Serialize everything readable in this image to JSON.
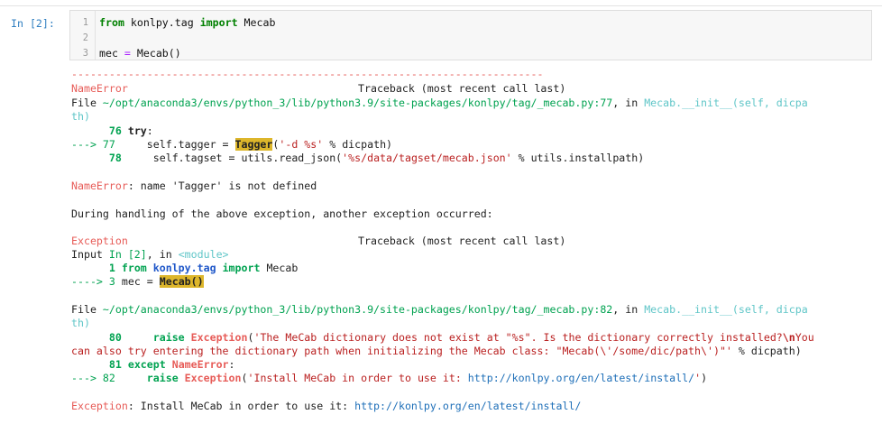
{
  "cell": {
    "prompt": "In [2]:",
    "lines": [
      {
        "num": "1",
        "kw1": "from",
        "mod": " konlpy.tag ",
        "kw2": "import",
        "name": " Mecab"
      },
      {
        "num": "2"
      },
      {
        "num": "3",
        "lhs": "mec ",
        "op": "=",
        "rhs": " Mecab()"
      }
    ]
  },
  "traceback": {
    "separator": "---------------------------------------------------------------------------",
    "first": {
      "error_name": "NameError",
      "header_right": "Traceback (most recent call last)",
      "file_prefix": "File ",
      "file_path": "~/opt/anaconda3/envs/python_3/lib/python3.9/site-packages/konlpy/tag/_mecab.py:77",
      "in_text": ", in ",
      "func": "Mecab.__init__(self, dicpa",
      "func_wrap": "th)",
      "l76_num": "76",
      "l76_kw": "try",
      "l76_colon": ":",
      "l77_arrow": "---> 77",
      "l77_pre": "     self.tagger = ",
      "l77_hl": "Tagger",
      "l77_open": "(",
      "l77_str": "'-d %s'",
      "l77_rest": " % dicpath)",
      "l78_num": "78",
      "l78_pre": "     self.tagset = utils.read_json(",
      "l78_str": "'%s/data/tagset/mecab.json'",
      "l78_rest": " % utils.installpath)",
      "msg_name": "NameError",
      "msg_text": ": name 'Tagger' is not defined"
    },
    "handling": "During handling of the above exception, another exception occurred:",
    "second": {
      "error_name": "Exception",
      "header_right": "Traceback (most recent call last)",
      "input_prefix": "Input ",
      "input_ref": "In [2]",
      "input_in": ", in ",
      "module": "<module>",
      "l1_num": "1",
      "l1_kw": "from",
      "l1_mod": "konlpy.tag",
      "l1_kw2": "import",
      "l1_name": "Mecab",
      "l3_arrow": "----> 3",
      "l3_pre": " mec = ",
      "l3_hl": "Mecab()"
    },
    "third": {
      "file_prefix": "File ",
      "file_path": "~/opt/anaconda3/envs/python_3/lib/python3.9/site-packages/konlpy/tag/_mecab.py:82",
      "in_text": ", in ",
      "func": "Mecab.__init__(self, dicpa",
      "func_wrap": "th)",
      "l80_num": "80",
      "l80_kw": "raise",
      "l80_exc": "Exception",
      "l80_paren": "(",
      "l80_str1": "'The MeCab dictionary does not exist at \"%s\". Is the dictionary correctly installed?",
      "l80_esc": "\\n",
      "l80_str1b": "You",
      "l80_str2": "can also try entering the dictionary path when initializing the Mecab class: \"Mecab(\\'/some/dic/path\\')\"'",
      "l80_rest": " % dicpath)",
      "l81_num": "81",
      "l81_kw": "except",
      "l81_exc": "NameError",
      "l81_colon": ":",
      "l82_arrow": "---> 82",
      "l82_kw": "raise",
      "l82_exc": "Exception",
      "l82_paren": "(",
      "l82_str": "'Install MeCab in order to use it: ",
      "l82_url": "http://konlpy.org/en/latest/install/",
      "l82_strend": "'",
      "l82_close": ")"
    },
    "final": {
      "name": "Exception",
      "text": ": Install MeCab in order to use it: ",
      "url": "http://konlpy.org/en/latest/install/"
    }
  }
}
